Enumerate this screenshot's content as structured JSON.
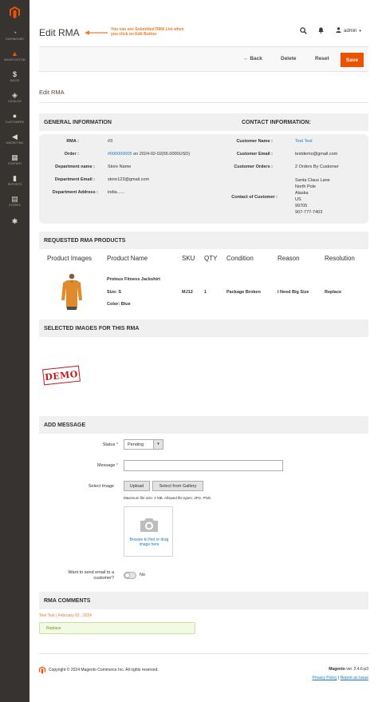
{
  "sidebar": {
    "items": [
      {
        "label": "DASHBOARD",
        "icon": "dashboard-icon"
      },
      {
        "label": "MAGECUSTOM",
        "icon": "magecustom-icon"
      },
      {
        "label": "SALES",
        "icon": "dollar-icon"
      },
      {
        "label": "CATALOG",
        "icon": "box-icon"
      },
      {
        "label": "CUSTOMERS",
        "icon": "person-icon"
      },
      {
        "label": "MARKETING",
        "icon": "megaphone-icon"
      },
      {
        "label": "CONTENT",
        "icon": "layout-icon"
      },
      {
        "label": "REPORTS",
        "icon": "bar-chart-icon"
      },
      {
        "label": "STORES",
        "icon": "store-icon"
      },
      {
        "label": "",
        "icon": "gear-icon"
      }
    ]
  },
  "header": {
    "title": "Edit RMA",
    "annotation": "You can see Submitted RMA List when you click on Edit Button",
    "user": "admin"
  },
  "actions": {
    "back": "Back",
    "delete": "Delete",
    "reset": "Reset",
    "save": "Save"
  },
  "subtitle": "Edit RMA",
  "general": {
    "heading": "GENERAL INFORMATION",
    "rma_label": "RMA :",
    "rma_value": "#3",
    "order_label": "Order :",
    "order_link": "#000000005",
    "order_rest": " on 2024-02-02(65.0000USD)",
    "dept_name_label": "Department name :",
    "dept_name_value": "Store Name",
    "dept_email_label": "Department Email :",
    "dept_email_value": "store123@gmail.com",
    "dept_address_label": "Department Address :",
    "dept_address_value": "india......"
  },
  "contact": {
    "heading": "CONTACT INFORMATION:",
    "name_label": "Customer Name :",
    "name_value": "Test Test",
    "email_label": "Customer Email :",
    "email_value": "testdemo@gmail.com",
    "orders_label": "Customer Orders :",
    "orders_value": "2 Orders By Customer",
    "contact_label": "Contact of Customer :",
    "address_lines": [
      "Santa Claus Lane",
      "North Pole",
      "Alaska",
      "US",
      "99705",
      "907-777-7403"
    ]
  },
  "products": {
    "heading": "REQUESTED RMA PRODUCTS",
    "columns": [
      "Product Images",
      "Product Name",
      "SKU",
      "QTY",
      "Condition",
      "Reason",
      "Resolution"
    ],
    "row": {
      "name": "Proteus Fitness Jackshirt",
      "size": "Size: S",
      "color": "Color: Blue",
      "sku": "MJ12",
      "qty": "1",
      "condition": "Package Broken",
      "reason": "I Need Big Size",
      "resolution": "Replace"
    }
  },
  "images": {
    "heading": "SELECTED IMAGES FOR THIS RMA",
    "stamp": "DEMO"
  },
  "message": {
    "heading": "ADD MESSAGE",
    "status_label": "Status",
    "status_value": "Pending",
    "message_label": "Message",
    "select_image_label": "Select Image",
    "upload": "Upload",
    "gallery": "Select from Gallery",
    "note": "Maximum file size: 2 MB. Allowed file types: JPG, PNG.",
    "browse": "Browse to find or drag image here",
    "email_label": "Want to send email to a customer?",
    "email_value": "No"
  },
  "comments": {
    "heading": "RMA COMMENTS",
    "author": "Test Test | February 02 , 2024",
    "text": "Replace"
  },
  "footer": {
    "copyright": "Copyright © 2024 Magento Commerce Inc. All rights reserved.",
    "brand": "Magento",
    "version": "ver. 2.4.6-p3",
    "privacy": "Privacy Policy",
    "report": "Report an Issue",
    "separator": "|"
  },
  "colors": {
    "accent": "#eb5202",
    "link": "#1979c3",
    "sidebar": "#373330"
  }
}
